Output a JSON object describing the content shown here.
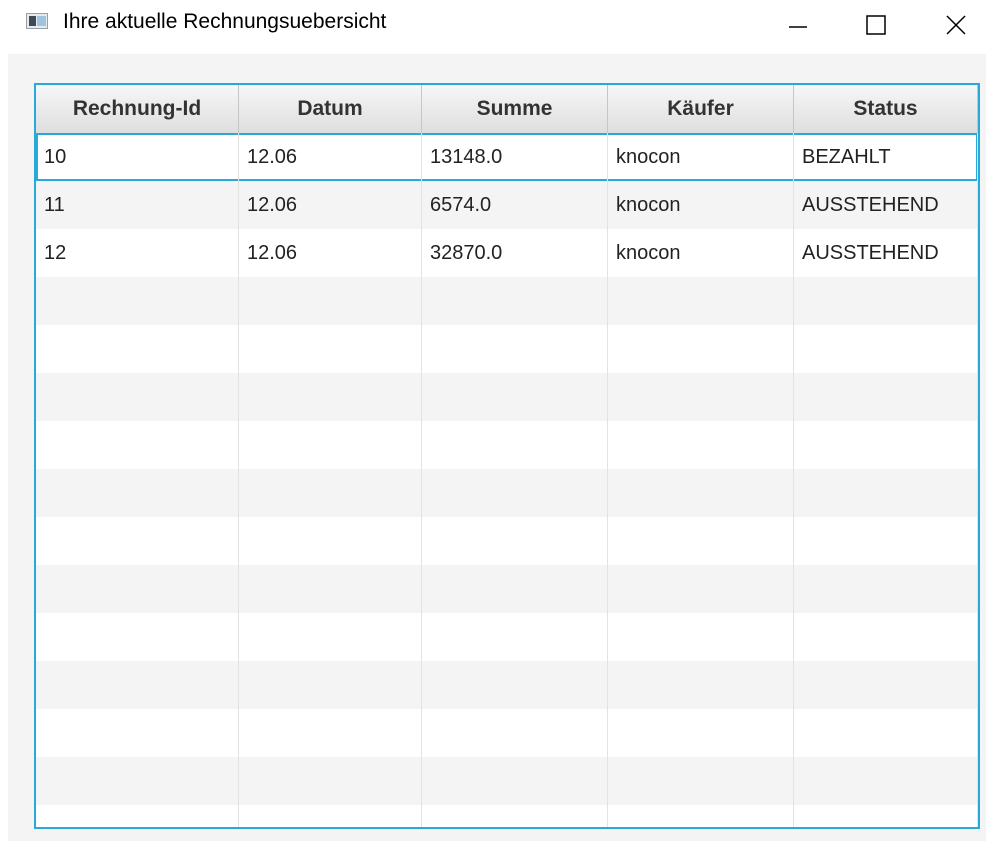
{
  "window": {
    "title": "Ihre aktuelle Rechnungsuebersicht"
  },
  "table": {
    "columns": [
      "Rechnung-Id",
      "Datum",
      "Summe",
      "Käufer",
      "Status"
    ],
    "rows": [
      [
        "10",
        "12.06",
        "13148.0",
        "knocon",
        "BEZAHLT"
      ],
      [
        "11",
        "12.06",
        "6574.0",
        "knocon",
        "AUSSTEHEND"
      ],
      [
        "12",
        "12.06",
        "32870.0",
        "knocon",
        "AUSSTEHEND"
      ]
    ],
    "selected_row": 0
  },
  "colors": {
    "accent": "#29a8da"
  }
}
